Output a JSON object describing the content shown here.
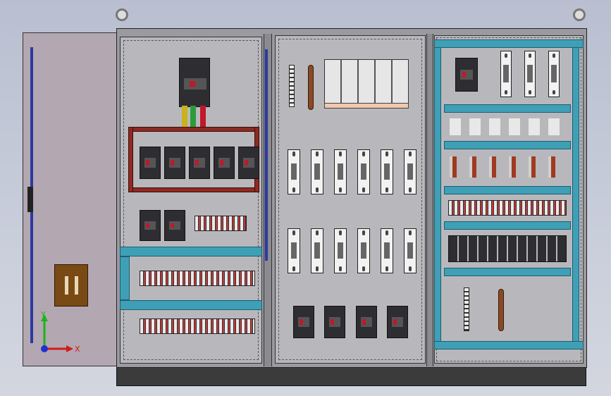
{
  "axes": {
    "x_label": "X",
    "y_label": "Y"
  },
  "colors": {
    "accent_teal": "#3f9fb6",
    "busbar": "#8e2a22",
    "breaker_body": "#2e2e32",
    "indicator_red": "#c0182a"
  },
  "icons": [
    "lifting-eye-icon",
    "axis-triad-icon",
    "door-handle-icon"
  ]
}
